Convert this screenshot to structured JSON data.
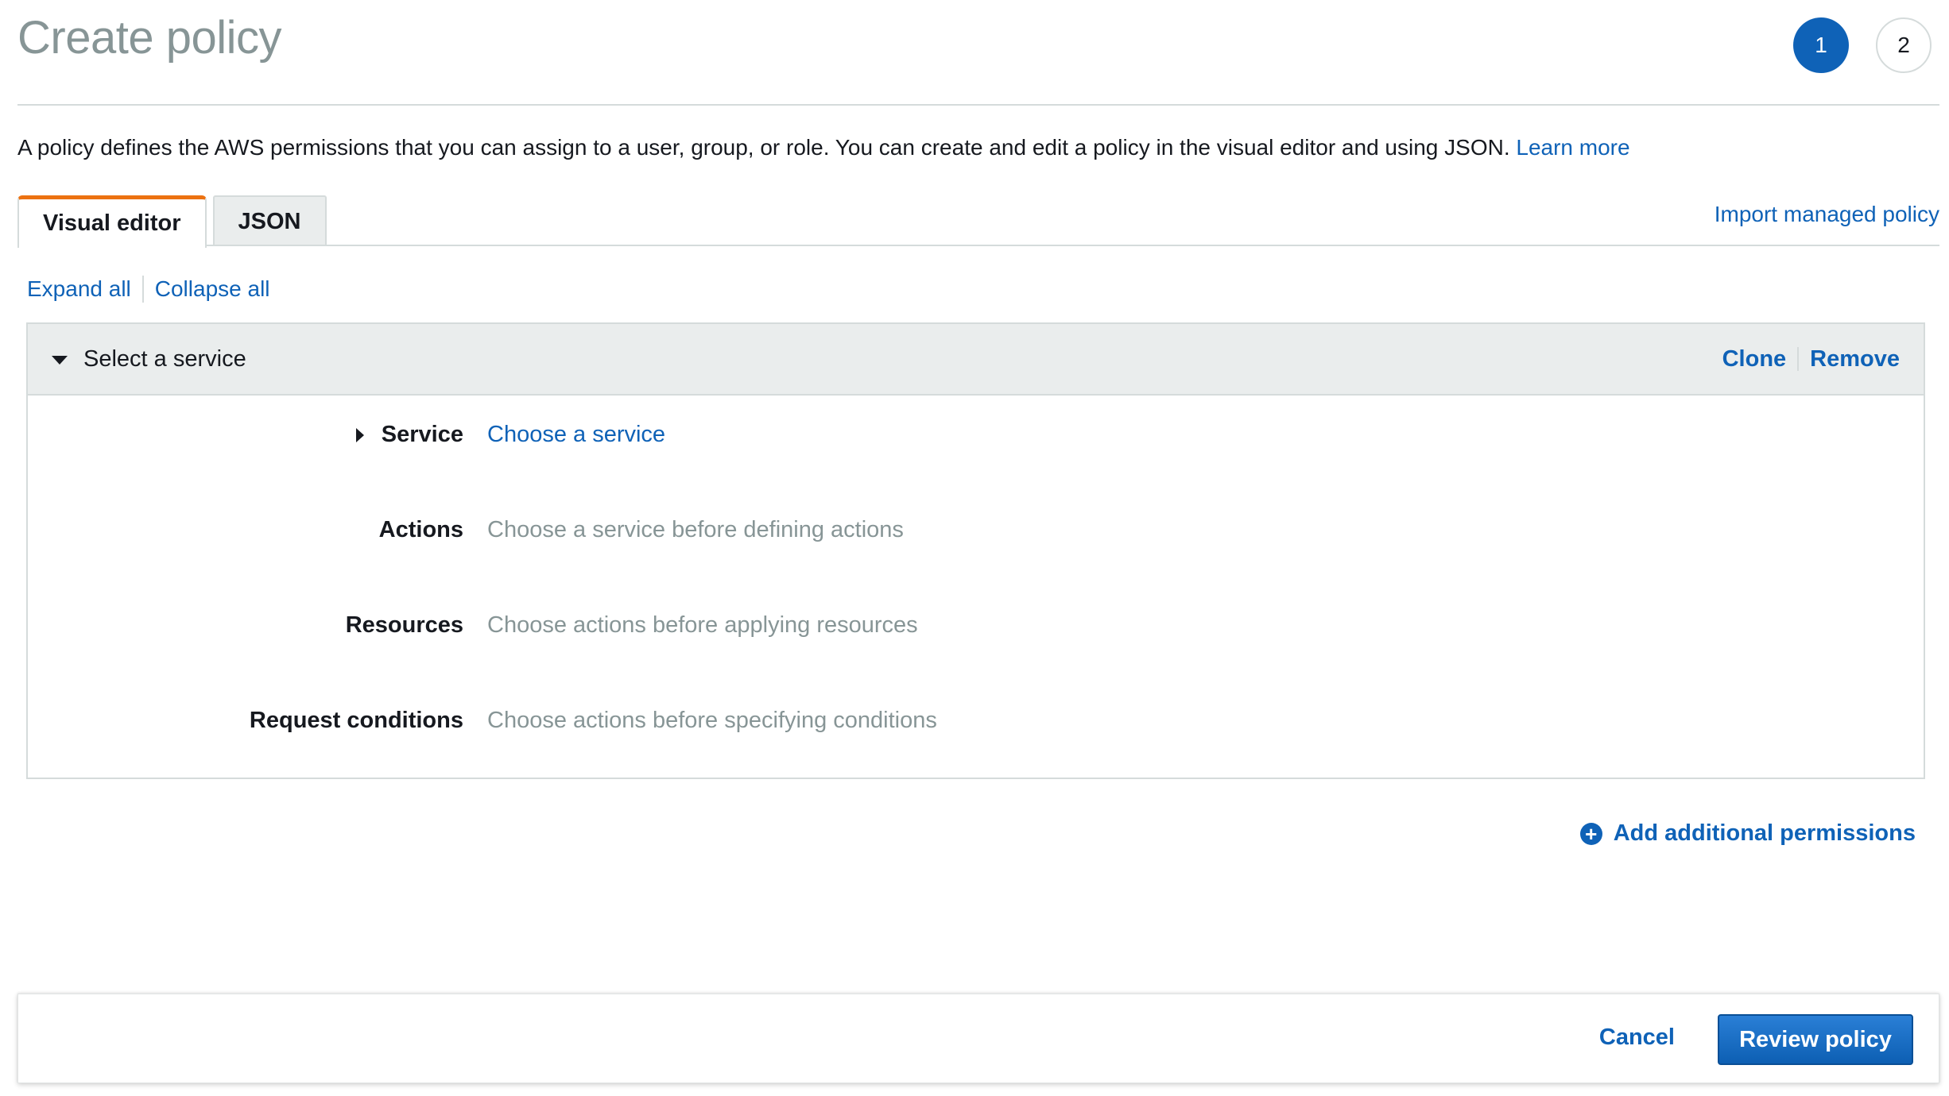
{
  "header": {
    "title": "Create policy",
    "steps": [
      "1",
      "2"
    ],
    "active_step": "1"
  },
  "intro": {
    "text": "A policy defines the AWS permissions that you can assign to a user, group, or role. You can create and edit a policy in the visual editor and using JSON.",
    "learn_more": "Learn more"
  },
  "tabs": [
    {
      "label": "Visual editor",
      "active": true
    },
    {
      "label": "JSON",
      "active": false
    }
  ],
  "import_link": "Import managed policy",
  "expand_all": "Expand all",
  "collapse_all": "Collapse all",
  "policy": {
    "header_label": "Select a service",
    "clone": "Clone",
    "remove": "Remove",
    "rows": [
      {
        "label": "Service",
        "value": "Choose a service"
      },
      {
        "label": "Actions",
        "value": "Choose a service before defining actions"
      },
      {
        "label": "Resources",
        "value": "Choose actions before applying resources"
      },
      {
        "label": "Request conditions",
        "value": "Choose actions before specifying conditions"
      }
    ]
  },
  "add_permissions": "Add additional permissions",
  "footer": {
    "cancel": "Cancel",
    "review": "Review policy"
  },
  "colors": {
    "accent_blue": "#0f62b7",
    "tab_active_orange": "#ec7211",
    "muted_text": "#879596",
    "border": "#d5dbdb"
  }
}
